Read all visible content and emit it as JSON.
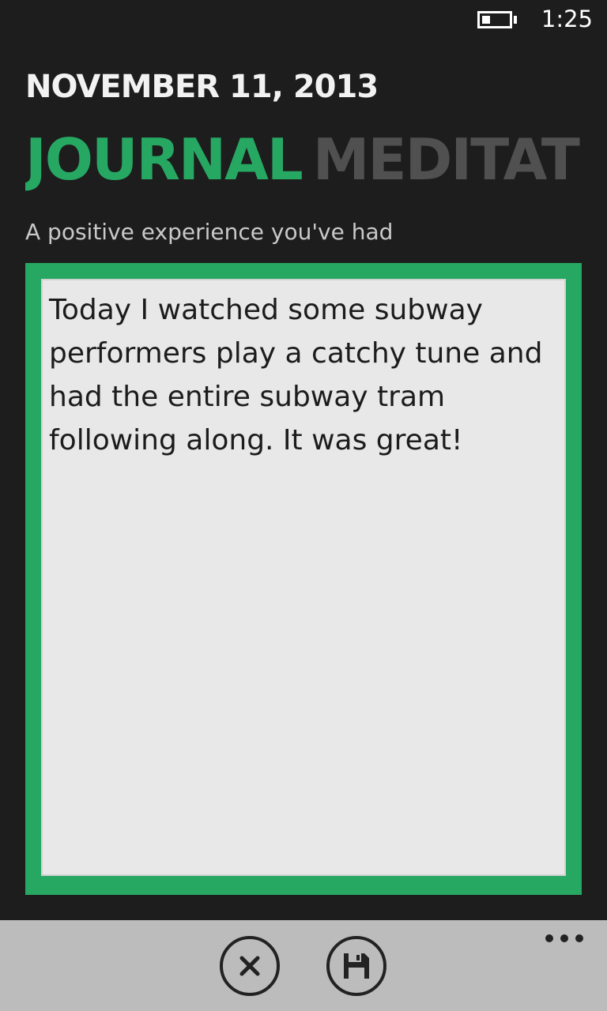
{
  "status_bar": {
    "time": "1:25",
    "battery_icon": "battery-low-icon"
  },
  "header": {
    "date": "NOVEMBER 11, 2013"
  },
  "pivot": {
    "tabs": [
      {
        "label": "JOURNAL",
        "active": true
      },
      {
        "label": "MEDITAT",
        "active": false
      }
    ]
  },
  "entry": {
    "prompt": "A positive experience you've had",
    "text": "Today I watched some subway performers play a catchy tune and had the entire subway tram following along. It was great!"
  },
  "app_bar": {
    "cancel_icon": "close-icon",
    "save_icon": "save-icon",
    "more_icon": "more-options-icon"
  },
  "colors": {
    "accent": "#26a863",
    "background": "#1d1d1d",
    "app_bar": "#bcbcbc",
    "entry_background": "#e8e8e8"
  }
}
